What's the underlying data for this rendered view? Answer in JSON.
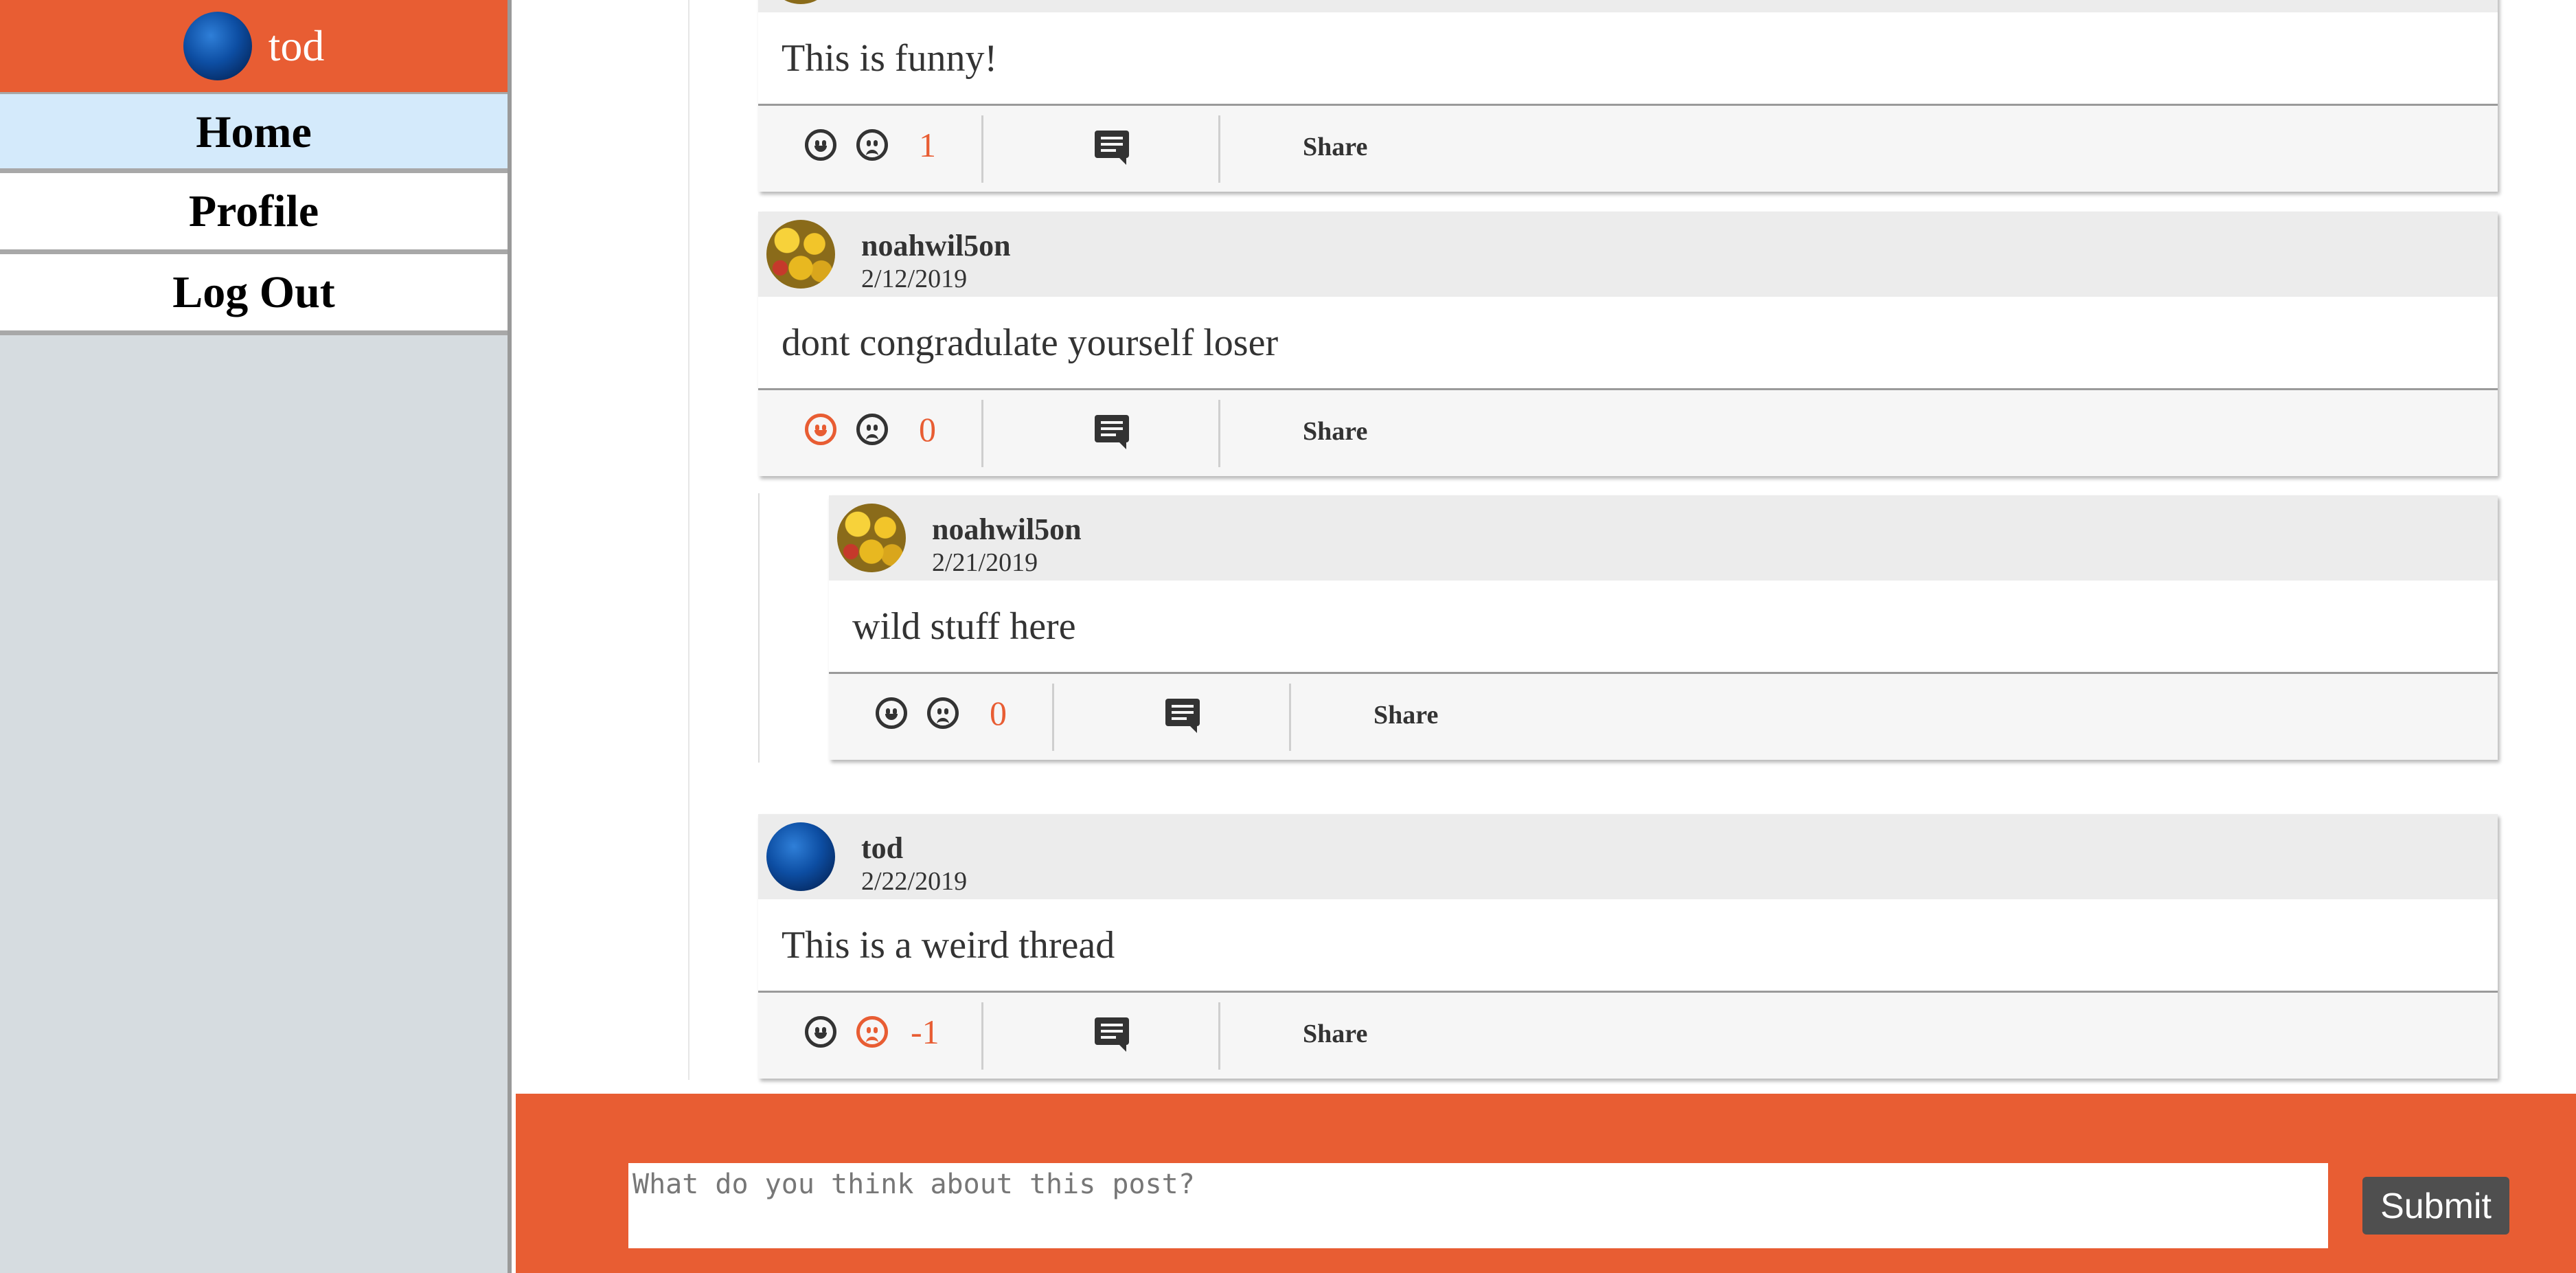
{
  "user": {
    "name": "tod"
  },
  "nav": {
    "items": [
      {
        "label": "Home",
        "active": true
      },
      {
        "label": "Profile",
        "active": false
      },
      {
        "label": "Log Out",
        "active": false
      }
    ]
  },
  "comments": [
    {
      "author": "",
      "date": "",
      "text": "This is funny!",
      "score": "1",
      "vote": "none",
      "share_label": "Share"
    },
    {
      "author": "noahwil5on",
      "date": "2/12/2019",
      "text": "dont congradulate yourself loser",
      "score": "0",
      "vote": "up",
      "share_label": "Share"
    },
    {
      "author": "noahwil5on",
      "date": "2/21/2019",
      "text": "wild stuff here",
      "score": "0",
      "vote": "none",
      "share_label": "Share"
    },
    {
      "author": "tod",
      "date": "2/22/2019",
      "text": "This is a weird thread",
      "score": "-1",
      "vote": "down",
      "share_label": "Share"
    }
  ],
  "reply": {
    "placeholder": "What do you think about this post?",
    "submit_label": "Submit"
  },
  "colors": {
    "accent": "#e85d33",
    "active_nav": "#d4eafb",
    "sidebar_bg": "#d6dce0"
  }
}
